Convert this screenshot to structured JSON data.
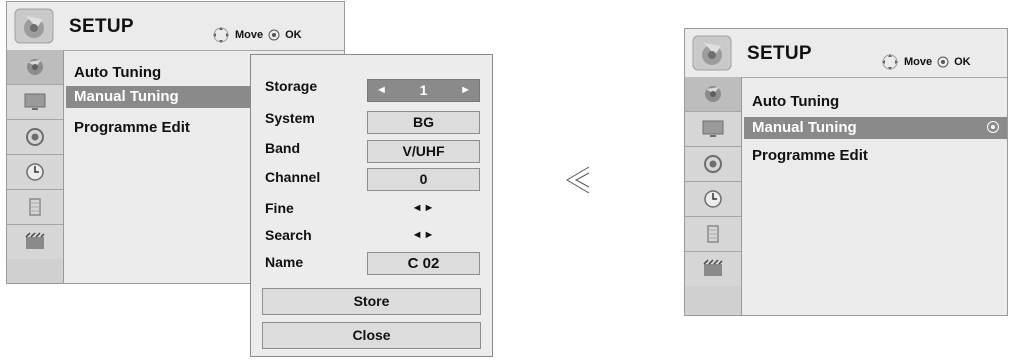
{
  "left": {
    "title": "SETUP",
    "hint_move": "Move",
    "hint_ok": "OK",
    "menu": [
      "Auto Tuning",
      "Manual Tuning",
      "Programme Edit"
    ],
    "manual": {
      "fields": [
        {
          "label": "Storage",
          "value": "1"
        },
        {
          "label": "System",
          "value": "BG"
        },
        {
          "label": "Band",
          "value": "V/UHF"
        },
        {
          "label": "Channel",
          "value": "0"
        },
        {
          "label": "Fine",
          "value": "◄►"
        },
        {
          "label": "Search",
          "value": "◄►"
        },
        {
          "label": "Name",
          "value": "C 02"
        }
      ],
      "store": "Store",
      "close": "Close"
    }
  },
  "connector": "≪",
  "right": {
    "title": "SETUP",
    "hint_move": "Move",
    "hint_ok": "OK",
    "menu": [
      "Auto Tuning",
      "Manual Tuning",
      "Programme Edit"
    ]
  },
  "rail_icons": [
    "picture-icon",
    "screen-icon",
    "audio-icon",
    "time-icon",
    "lock-icon",
    "input-icon"
  ]
}
